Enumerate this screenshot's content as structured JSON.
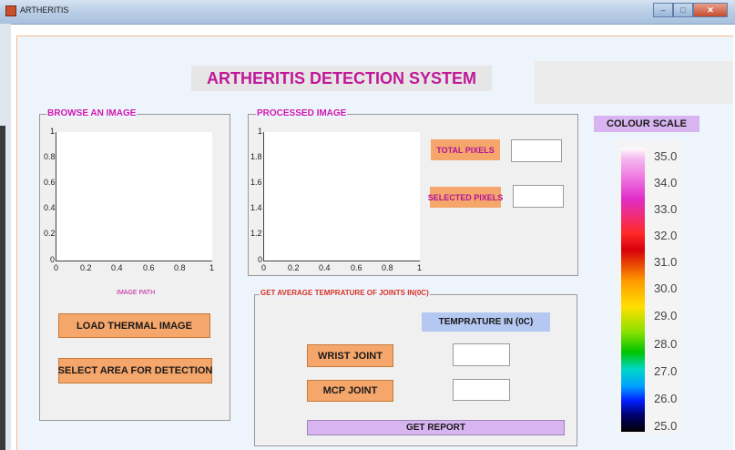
{
  "window": {
    "title": "ARTHERITIS"
  },
  "app": {
    "title": "ARTHERITIS DETECTION SYSTEM"
  },
  "browse_panel": {
    "title": "BROWSE AN IMAGE",
    "image_path_label": "IMAGE PATH",
    "load_button": "LOAD THERMAL IMAGE",
    "select_button": "SELECT AREA FOR DETECTION"
  },
  "processed_panel": {
    "title": "PROCESSED IMAGE",
    "total_pixels_label": "TOTAL PIXELS",
    "selected_pixels_label": "SELECTED PIXELS",
    "total_pixels_value": "",
    "selected_pixels_value": ""
  },
  "axes_ticks": {
    "y": [
      "1",
      "0.8",
      "0.6",
      "0.4",
      "0.2",
      "0"
    ],
    "x": [
      "0",
      "0.2",
      "0.4",
      "0.6",
      "0.8",
      "1"
    ],
    "processed_y": [
      "1",
      "1.8",
      "1.6",
      "1.4",
      "1.2",
      "0"
    ]
  },
  "temperature_panel": {
    "title": "GET AVERAGE TEMPRATURE OF JOINTS IN(0C)",
    "header": "TEMPRATURE IN (0C)",
    "wrist_button": "WRIST JOINT",
    "mcp_button": "MCP JOINT",
    "wrist_value": "",
    "mcp_value": "",
    "report_button": "GET REPORT"
  },
  "colour_scale": {
    "title": "COLOUR SCALE",
    "labels": [
      "35.0",
      "34.0",
      "33.0",
      "32.0",
      "31.0",
      "30.0",
      "29.0",
      "28.0",
      "27.0",
      "26.0",
      "25.0"
    ]
  },
  "colors": {
    "title_text": "#c0189a",
    "button_orange": "#f5a66a",
    "lilac": "#d8b4f0",
    "blue_label": "#b4c8f2"
  }
}
